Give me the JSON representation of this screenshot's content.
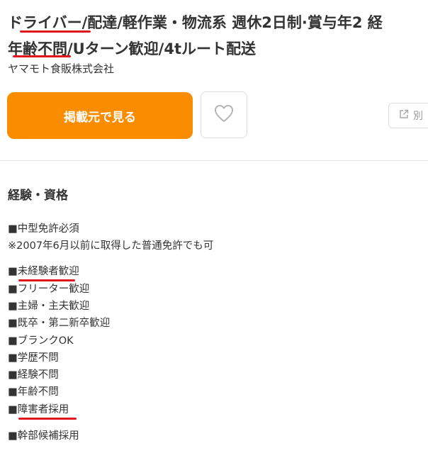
{
  "job": {
    "title_line1": "ドライバー/配達/軽作業・物流系 週休2日制·賞与年2 経",
    "title_line2": "年齢不問/Uターン歓迎/4tルート配送",
    "company": "ヤマモト食販株式会社"
  },
  "actions": {
    "primary_label": "掲載元で見る",
    "favorite_icon": "heart-outline-icon",
    "external_label": "別",
    "external_icon": "external-link-icon"
  },
  "requirements": {
    "heading": "経験・資格",
    "items": [
      "■中型免許必須",
      "※2007年6月以前に取得した普通免許でも可",
      "■未経験者歓迎",
      "■フリーター歓迎",
      "■主婦・主夫歓迎",
      "■既卒・第二新卒歓迎",
      "■ブランクOK",
      "■学歴不問",
      "■経験不問",
      "■年齢不問",
      "■障害者採用",
      "■幹部候補採用"
    ]
  },
  "colors": {
    "accent": "#fa8c00",
    "highlight_underline": "#e0161e",
    "text": "#333333",
    "border": "#dcdcdc"
  }
}
